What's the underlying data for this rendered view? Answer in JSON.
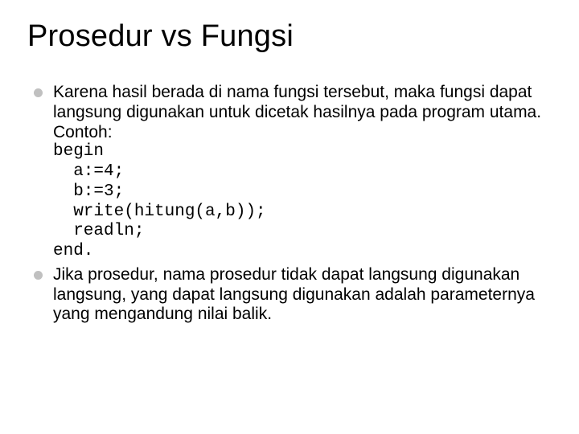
{
  "title": "Prosedur vs Fungsi",
  "bullets": [
    {
      "text": "Karena hasil berada di nama fungsi tersebut, maka fungsi dapat langsung digunakan untuk dicetak hasilnya pada program utama.",
      "subtext": "Contoh:",
      "code": "begin\n  a:=4;\n  b:=3;\n  write(hitung(a,b));\n  readln;\nend."
    },
    {
      "text": "Jika prosedur, nama prosedur tidak dapat langsung digunakan langsung, yang dapat langsung digunakan adalah parameternya yang mengandung nilai balik."
    }
  ]
}
